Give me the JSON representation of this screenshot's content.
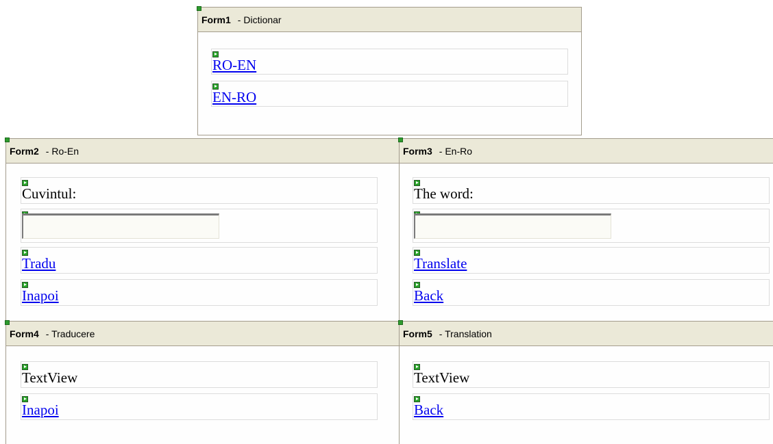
{
  "forms": {
    "form1": {
      "name": "Form1",
      "subtitle": "- Dictionar",
      "links": [
        "RO-EN",
        "EN-RO"
      ]
    },
    "form2": {
      "name": "Form2",
      "subtitle": "- Ro-En",
      "label": "Cuvintul:",
      "input_value": "",
      "translate": "Tradu",
      "back": "Inapoi"
    },
    "form3": {
      "name": "Form3",
      "subtitle": "- En-Ro",
      "label": "The word:",
      "input_value": "",
      "translate": "Translate",
      "back": "Back"
    },
    "form4": {
      "name": "Form4",
      "subtitle": "- Traducere",
      "text": "TextView",
      "back": "Inapoi"
    },
    "form5": {
      "name": "Form5",
      "subtitle": "- Translation",
      "text": "TextView",
      "back": "Back"
    }
  },
  "colors": {
    "header_bg": "#ebe9d8",
    "border": "#a39c8c",
    "link": "#0000ee",
    "indicator": "#27a327"
  },
  "icons": {
    "control_indicator": "green-play-marker-icon"
  }
}
